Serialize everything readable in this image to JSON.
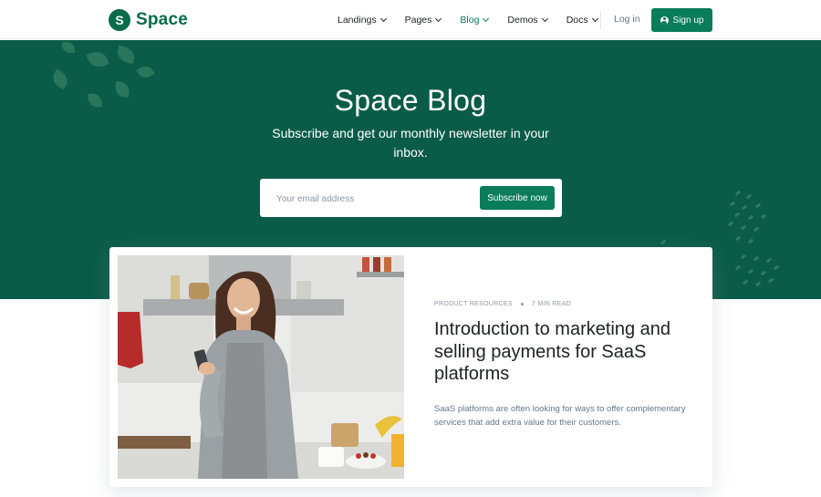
{
  "brand": {
    "logo_letter": "S",
    "name": "Space"
  },
  "nav": {
    "items": [
      {
        "label": "Landings",
        "active": false
      },
      {
        "label": "Pages",
        "active": false
      },
      {
        "label": "Blog",
        "active": true
      },
      {
        "label": "Demos",
        "active": false
      },
      {
        "label": "Docs",
        "active": false
      }
    ],
    "login_label": "Log in",
    "signup_label": "Sign up"
  },
  "hero": {
    "title": "Space Blog",
    "subtitle": "Subscribe and get our monthly newsletter in your inbox.",
    "email_placeholder": "Your email address",
    "email_value": "",
    "subscribe_label": "Subscribe now"
  },
  "featured_post": {
    "category": "PRODUCT RESOURCES",
    "read_time": "7 MIN READ",
    "title": "Introduction to marketing and selling payments for SaaS platforms",
    "description": "SaaS platforms are often looking for ways to offer complementary services that add extra value for their customers."
  },
  "colors": {
    "brand": "#0a7c5a",
    "hero_bg": "#0a5c48",
    "text_dark": "#1e2022",
    "text_muted": "#677788"
  },
  "icons": [
    "chevron-down-icon",
    "user-circle-icon"
  ]
}
